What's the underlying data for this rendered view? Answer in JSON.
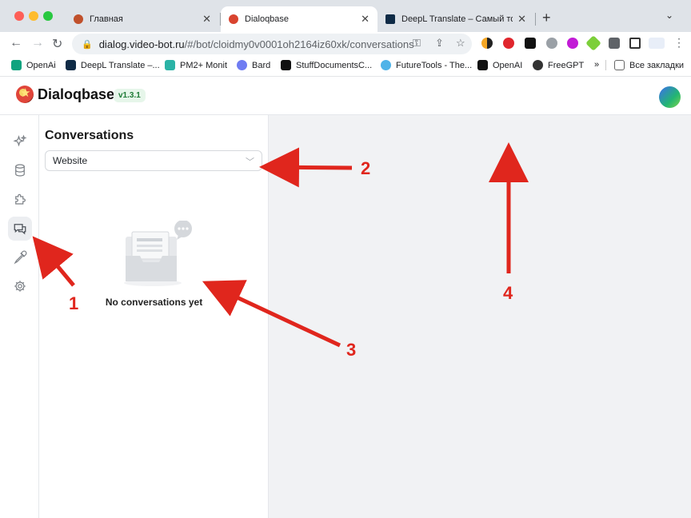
{
  "browser": {
    "tabs": [
      {
        "title": "Главная",
        "favicon_color": "#c0502b"
      },
      {
        "title": "Dialoqbase",
        "favicon_color": "#d9442f",
        "active": true
      },
      {
        "title": "DeepL Translate – Самый точ",
        "favicon_color": "#0f2b46"
      }
    ],
    "url_host": "dialog.video-bot.ru",
    "url_path": "/#/bot/cloidmy0v0001oh2164iz60xk/conversations",
    "bookmarks": [
      {
        "label": "OpenAi",
        "color": "#10a37f"
      },
      {
        "label": "DeepL Translate –...",
        "color": "#0f2b46"
      },
      {
        "label": "PM2+ Monit",
        "color": "#2bb3a6"
      },
      {
        "label": "Bard",
        "color": "#6f7cf2"
      },
      {
        "label": "StuffDocumentsC...",
        "color": "#111111"
      },
      {
        "label": "FutureTools - The...",
        "color": "#4fb3e8"
      },
      {
        "label": "OpenAI",
        "color": "#111111"
      },
      {
        "label": "FreeGPT",
        "color": "#333333"
      }
    ],
    "bookmarks_overflow": "»",
    "all_bookmarks_label": "Все закладки"
  },
  "app": {
    "name": "Dialoqbase",
    "version": "v1.3.1"
  },
  "sidebar": {
    "items": [
      {
        "name": "sparkles-icon"
      },
      {
        "name": "database-icon"
      },
      {
        "name": "puzzle-icon"
      },
      {
        "name": "chat-icon",
        "active": true
      },
      {
        "name": "pipette-icon"
      },
      {
        "name": "gear-icon"
      }
    ]
  },
  "conversations": {
    "title": "Conversations",
    "source_select": "Website",
    "empty_text": "No conversations yet"
  },
  "annotations": [
    "1",
    "2",
    "3",
    "4"
  ],
  "colors": {
    "annotation": "#e0261d",
    "version_badge_text": "#1e7a36",
    "main_background": "#f1f2f4"
  }
}
